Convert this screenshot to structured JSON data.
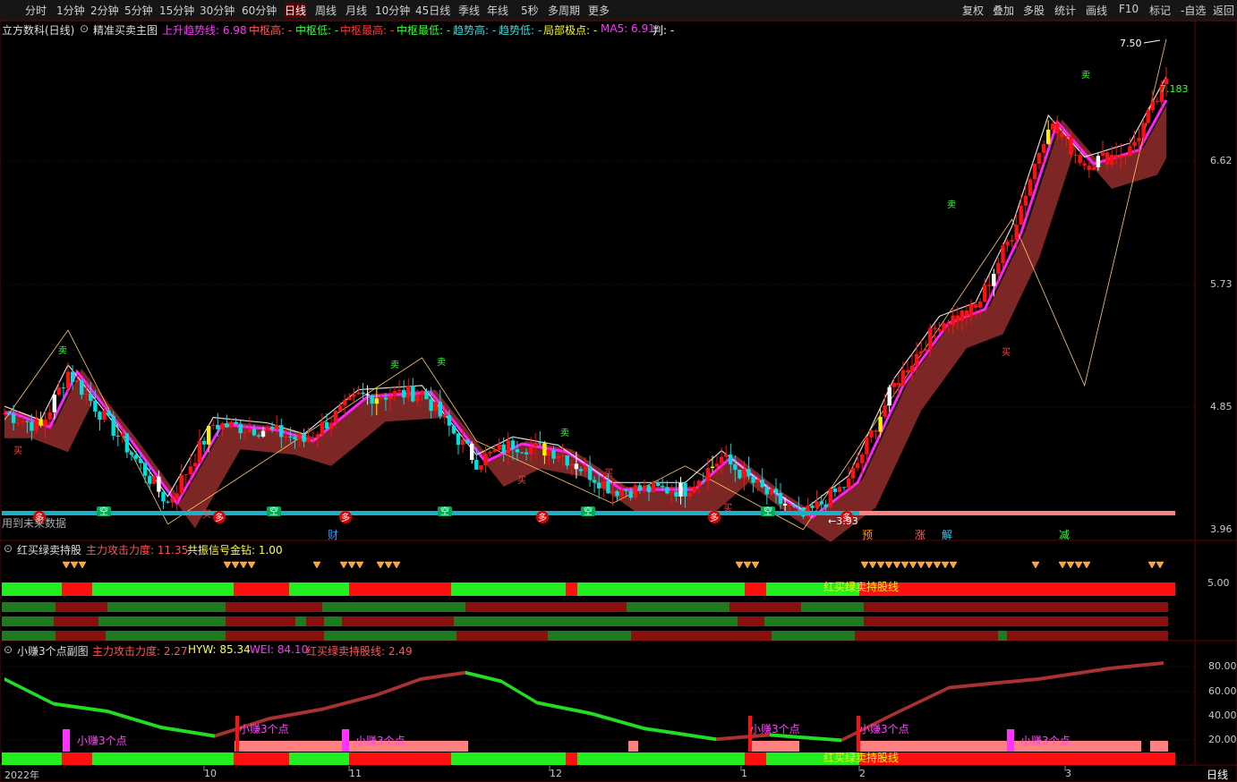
{
  "toolbar": {
    "left": [
      "分时",
      "1分钟",
      "2分钟",
      "5分钟",
      "15分钟",
      "30分钟",
      "60分钟",
      "日线",
      "周线",
      "月线",
      "10分钟",
      "45日线",
      "季线",
      "年线",
      "5秒",
      "多周期",
      "更多"
    ],
    "left_x": [
      28,
      63,
      101,
      139,
      178,
      223,
      270,
      318,
      352,
      386,
      419,
      464,
      512,
      544,
      582,
      612,
      657
    ],
    "selected": "日线",
    "right": [
      "复权",
      "叠加",
      "多股",
      "统计",
      "画线",
      "F10",
      "标记",
      "-自选",
      "返回"
    ],
    "right_x": [
      1075,
      1109,
      1143,
      1178,
      1213,
      1250,
      1284,
      1319,
      1355
    ]
  },
  "main": {
    "stock": "立方数科(日线)",
    "indicator": "精准买卖主图",
    "params": [
      {
        "text": "上升趋势线: 6.98",
        "color": "#ff33ff"
      },
      {
        "text": "中枢高: -",
        "color": "#ff5555"
      },
      {
        "text": "中枢低: -",
        "color": "#33ff33"
      },
      {
        "text": "中枢最高: -",
        "color": "#ff3333"
      },
      {
        "text": "中枢最低: -",
        "color": "#33ff33"
      },
      {
        "text": "趋势高: -",
        "color": "#33dddd"
      },
      {
        "text": "趋势低: -",
        "color": "#33dddd"
      },
      {
        "text": "局部极点: -",
        "color": "#ffff00"
      },
      {
        "text": "MA5: 6.91",
        "color": "#ff33ff"
      },
      {
        "text": "判: -",
        "color": "#ffffff"
      }
    ],
    "yaxis": [
      "6.62",
      "5.73",
      "4.85",
      "3.96"
    ],
    "high_label": "7.50",
    "last_label": "7.183",
    "note": "用到未来数据",
    "bottom_marks": [
      {
        "text": "财",
        "color": "#3399ff"
      },
      {
        "text": "预",
        "color": "#ff9900"
      },
      {
        "text": "涨",
        "color": "#ff5555"
      },
      {
        "text": "解",
        "color": "#33ccff"
      },
      {
        "text": "减",
        "color": "#33ff33"
      }
    ],
    "sig_duo": "多",
    "sig_kong": "空",
    "sig_mai": "卖",
    "sig_buy": "买",
    "low_label": "←3.93"
  },
  "panel2": {
    "title": "红买绿卖持股",
    "p1": "主力攻击力度: 11.35",
    "p2": "共振信号金钻: 1.00",
    "yaxis": "5.00",
    "bar_label": "红买绿卖持股线"
  },
  "panel3": {
    "title": "小赚3个点副图",
    "p1": "主力攻击力度: 2.27",
    "p2": "HYW: 85.34",
    "p3": "WEI: 84.10",
    "p4": "红买绿卖持股线: 2.49",
    "yaxis": [
      "80.00",
      "60.00",
      "40.00",
      "20.00"
    ],
    "marker": "小赚3个点",
    "bar_label": "红买绿卖持股线"
  },
  "xaxis": {
    "labels": [
      "2022年",
      "10",
      "11",
      "12",
      "1",
      "2",
      "3"
    ],
    "period": "日线"
  },
  "chart_data": {
    "type": "candlestick",
    "title": "立方数科(日线)",
    "ylim": [
      3.9,
      7.6
    ],
    "high": 7.5,
    "low": 3.93,
    "last": 7.183,
    "ma5": 6.91,
    "trend_line": 6.98
  }
}
